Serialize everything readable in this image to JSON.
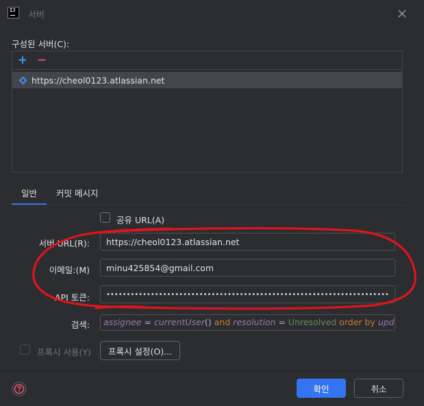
{
  "window": {
    "title": "서버",
    "app_icon_text": "IJ"
  },
  "configured_servers": {
    "label": "구성된 서버(C):",
    "add_symbol": "+",
    "remove_symbol": "−",
    "items": [
      {
        "url": "https://cheol0123.atlassian.net"
      }
    ]
  },
  "tabs": [
    {
      "label": "일반",
      "active": true
    },
    {
      "label": "커밋 메시지",
      "active": false
    }
  ],
  "general": {
    "share_url_label": "공유 URL(A)",
    "share_url_checked": false,
    "server_url_label": "서버 URL(R):",
    "server_url_value": "https://cheol0123.atlassian.net",
    "email_label": "이메일:(M)",
    "email_value": "minu425854@gmail.com",
    "api_token_label": "API 토큰:",
    "api_token_mask": "••••••••••••••••••••••••••••••••••••••••••••••••••••••••••••••••••••••",
    "search_label": "검색:",
    "search_query": {
      "field1": "assignee",
      "op1": " = ",
      "fn": "currentUser",
      "paren": "()",
      "and": " and ",
      "field2": "resolution",
      "op2": " = ",
      "value": "Unresolved",
      "order": " order by ",
      "field3": "updated"
    },
    "use_proxy_label": "프록시 사용(Y)",
    "use_proxy_checked": false,
    "proxy_settings_label": "프록시 설정(O)..."
  },
  "footer": {
    "ok_label": "확인",
    "cancel_label": "취소"
  },
  "colors": {
    "accent": "#3574f0",
    "annotation": "#e0141b",
    "background": "#2b2d30"
  }
}
